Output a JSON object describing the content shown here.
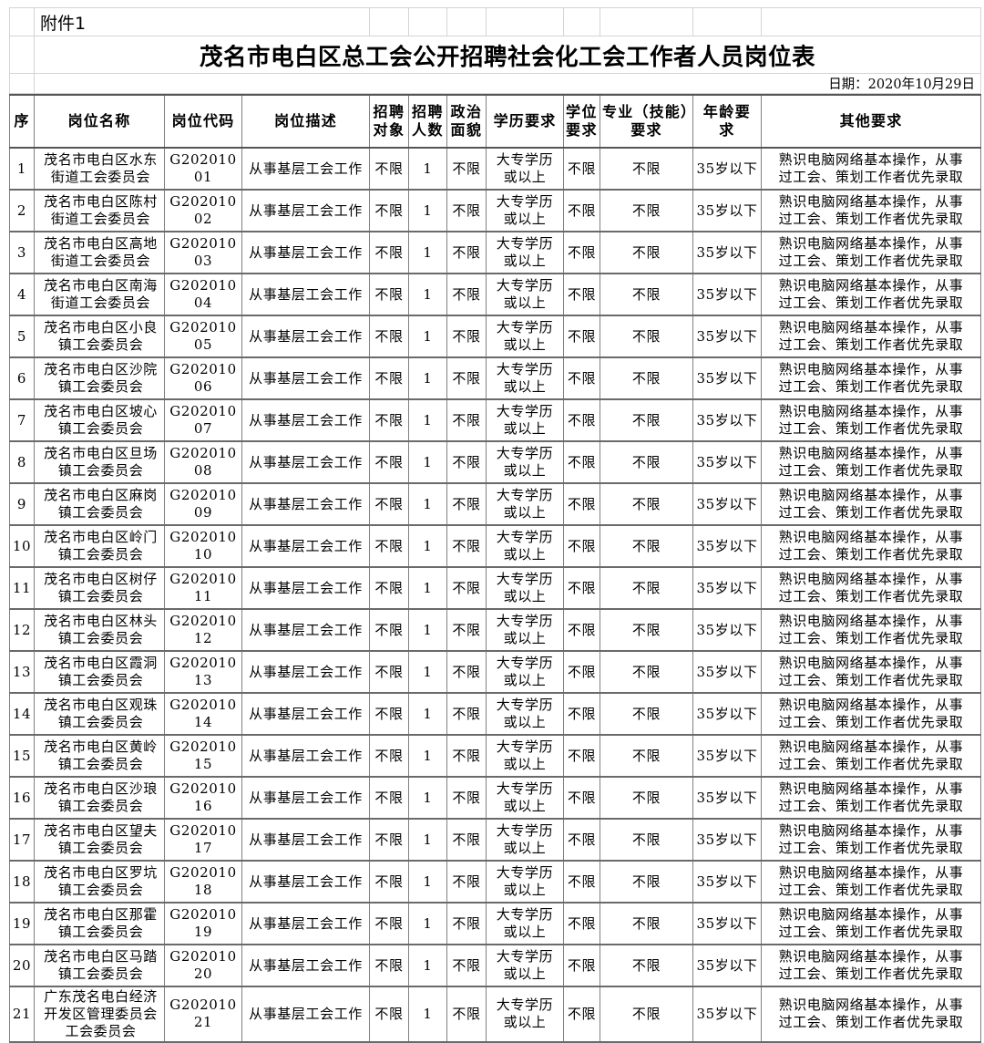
{
  "document": {
    "attachment_label": "附件1",
    "title": "茂名市电白区总工会公开招聘社会化工会工作者人员岗位表",
    "date_line": "日期：2020年10月29日"
  },
  "table": {
    "columns": [
      {
        "key": "seq",
        "label": "序",
        "label_l1": "序",
        "label_l2": ""
      },
      {
        "key": "name",
        "label": "岗位名称",
        "label_l1": "岗位名称",
        "label_l2": ""
      },
      {
        "key": "code",
        "label": "岗位代码",
        "label_l1": "岗位代码",
        "label_l2": ""
      },
      {
        "key": "desc",
        "label": "岗位描述",
        "label_l1": "岗位描述",
        "label_l2": ""
      },
      {
        "key": "target",
        "label": "招聘对象",
        "label_l1": "招聘",
        "label_l2": "对象"
      },
      {
        "key": "count",
        "label": "招聘人数",
        "label_l1": "招聘",
        "label_l2": "人数"
      },
      {
        "key": "politics",
        "label": "政治面貌",
        "label_l1": "政治",
        "label_l2": "面貌"
      },
      {
        "key": "edu",
        "label": "学历要求",
        "label_l1": "学历要求",
        "label_l2": ""
      },
      {
        "key": "degree",
        "label": "学位要求",
        "label_l1": "学位",
        "label_l2": "要求"
      },
      {
        "key": "major",
        "label": "专业（技能）要求",
        "label_l1": "专业（技能）",
        "label_l2": "要求"
      },
      {
        "key": "age",
        "label": "年龄要求",
        "label_l1": "年龄要",
        "label_l2": "求"
      },
      {
        "key": "other",
        "label": "其他要求",
        "label_l1": "其他要求",
        "label_l2": ""
      }
    ],
    "common": {
      "desc": "从事基层工会工作",
      "target": "不限",
      "count": "1",
      "politics": "不限",
      "edu_l1": "大专学历",
      "edu_l2": "或以上",
      "degree": "不限",
      "major": "不限",
      "age": "35岁以下",
      "other_l1": "熟识电脑网络基本操作，从事",
      "other_l2": "过工会、策划工作者优先录取"
    },
    "rows": [
      {
        "seq": "1",
        "name_l1": "茂名市电白区水东",
        "name_l2": "街道工会委员会",
        "name_l3": "",
        "code": "G20201001"
      },
      {
        "seq": "2",
        "name_l1": "茂名市电白区陈村",
        "name_l2": "街道工会委员会",
        "name_l3": "",
        "code": "G20201002"
      },
      {
        "seq": "3",
        "name_l1": "茂名市电白区高地",
        "name_l2": "街道工会委员会",
        "name_l3": "",
        "code": "G20201003"
      },
      {
        "seq": "4",
        "name_l1": "茂名市电白区南海",
        "name_l2": "街道工会委员会",
        "name_l3": "",
        "code": "G20201004"
      },
      {
        "seq": "5",
        "name_l1": "茂名市电白区小良",
        "name_l2": "镇工会委员会",
        "name_l3": "",
        "code": "G20201005"
      },
      {
        "seq": "6",
        "name_l1": "茂名市电白区沙院",
        "name_l2": "镇工会委员会",
        "name_l3": "",
        "code": "G20201006"
      },
      {
        "seq": "7",
        "name_l1": "茂名市电白区坡心",
        "name_l2": "镇工会委员会",
        "name_l3": "",
        "code": "G20201007"
      },
      {
        "seq": "8",
        "name_l1": "茂名市电白区旦场",
        "name_l2": "镇工会委员会",
        "name_l3": "",
        "code": "G20201008"
      },
      {
        "seq": "9",
        "name_l1": "茂名市电白区麻岗",
        "name_l2": "镇工会委员会",
        "name_l3": "",
        "code": "G20201009"
      },
      {
        "seq": "10",
        "name_l1": "茂名市电白区岭门",
        "name_l2": "镇工会委员会",
        "name_l3": "",
        "code": "G20201010"
      },
      {
        "seq": "11",
        "name_l1": "茂名市电白区树仔",
        "name_l2": "镇工会委员会",
        "name_l3": "",
        "code": "G20201011"
      },
      {
        "seq": "12",
        "name_l1": "茂名市电白区林头",
        "name_l2": "镇工会委员会",
        "name_l3": "",
        "code": "G20201012"
      },
      {
        "seq": "13",
        "name_l1": "茂名市电白区霞洞",
        "name_l2": "镇工会委员会",
        "name_l3": "",
        "code": "G20201013"
      },
      {
        "seq": "14",
        "name_l1": "茂名市电白区观珠",
        "name_l2": "镇工会委员会",
        "name_l3": "",
        "code": "G20201014"
      },
      {
        "seq": "15",
        "name_l1": "茂名市电白区黄岭",
        "name_l2": "镇工会委员会",
        "name_l3": "",
        "code": "G20201015"
      },
      {
        "seq": "16",
        "name_l1": "茂名市电白区沙琅",
        "name_l2": "镇工会委员会",
        "name_l3": "",
        "code": "G20201016"
      },
      {
        "seq": "17",
        "name_l1": "茂名市电白区望夫",
        "name_l2": "镇工会委员会",
        "name_l3": "",
        "code": "G20201017"
      },
      {
        "seq": "18",
        "name_l1": "茂名市电白区罗坑",
        "name_l2": "镇工会委员会",
        "name_l3": "",
        "code": "G20201018"
      },
      {
        "seq": "19",
        "name_l1": "茂名市电白区那霍",
        "name_l2": "镇工会委员会",
        "name_l3": "",
        "code": "G20201019"
      },
      {
        "seq": "20",
        "name_l1": "茂名市电白区马踏",
        "name_l2": "镇工会委员会",
        "name_l3": "",
        "code": "G20201020"
      },
      {
        "seq": "21",
        "name_l1": "广东茂名电白经济",
        "name_l2": "开发区管理委员会",
        "name_l3": "工会委员会",
        "code": "G20201021"
      }
    ]
  }
}
